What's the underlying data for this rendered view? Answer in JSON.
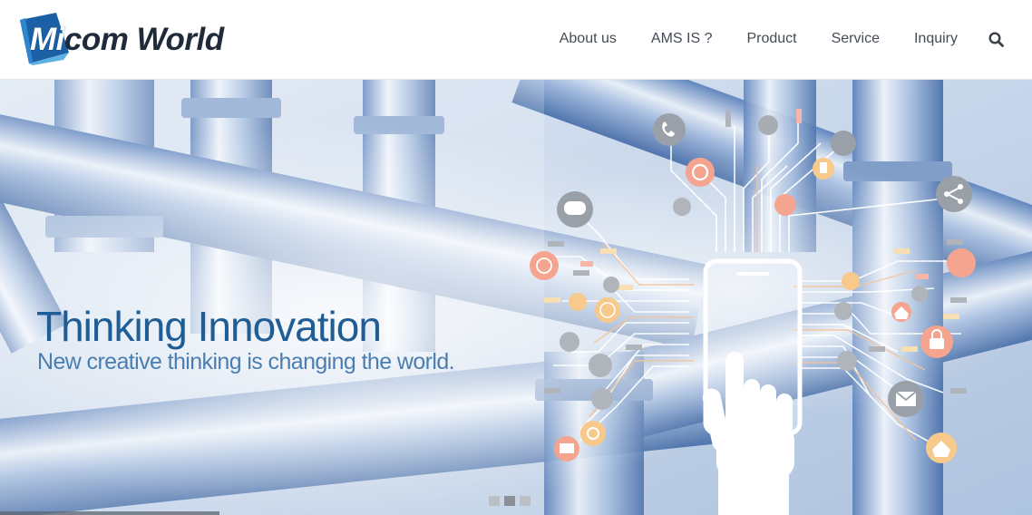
{
  "logo": {
    "text_part1": "Mi",
    "text_part2": "com World",
    "colors": {
      "mark_primary": "#1b5fa4",
      "mark_light": "#5fb0e2",
      "text": "#1f2b3a"
    }
  },
  "nav": {
    "items": [
      {
        "label": "About us"
      },
      {
        "label": "AMS IS ?"
      },
      {
        "label": "Product"
      },
      {
        "label": "Service"
      },
      {
        "label": "Inquiry"
      }
    ],
    "search_icon": "search-icon"
  },
  "hero": {
    "title": "Thinking Innovation",
    "subtitle": "New creative thinking is changing the world.",
    "slide_count": 3,
    "active_slide": 2,
    "colors": {
      "title": "#1f5d96",
      "subtitle": "#4a7eb0",
      "pipes": "#7e9fcc"
    },
    "illustration_icons": [
      "phone-icon",
      "refresh-icon",
      "chat-icon",
      "share-icon",
      "globe-icon",
      "music-icon",
      "cloud-icon",
      "lock-icon",
      "mail-icon",
      "home-icon",
      "bookmark-icon",
      "plus-icon",
      "touch-hand-icon",
      "smartphone-icon"
    ]
  }
}
